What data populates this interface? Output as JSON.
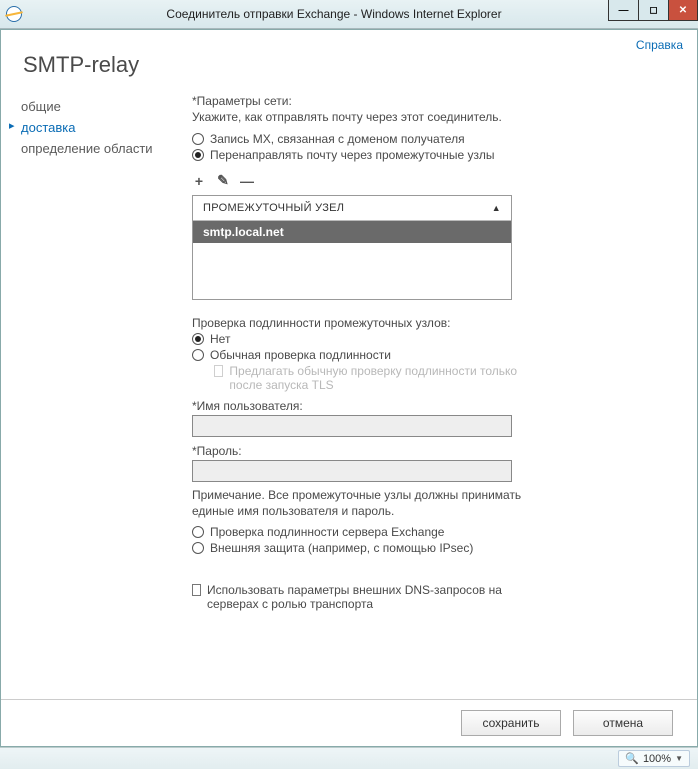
{
  "window": {
    "title": "Соединитель отправки Exchange - Windows Internet Explorer"
  },
  "header": {
    "help": "Справка",
    "page_title": "SMTP-relay"
  },
  "sidebar": {
    "items": [
      {
        "label": "общие",
        "active": false
      },
      {
        "label": "доставка",
        "active": true
      },
      {
        "label": "определение области",
        "active": false
      }
    ]
  },
  "network": {
    "label": "*Параметры сети:",
    "desc": "Укажите, как отправлять почту через этот соединитель.",
    "opt_mx": "Запись MX, связанная с доменом получателя",
    "opt_smarthost": "Перенаправлять почту через промежуточные узлы",
    "selected": "smarthost"
  },
  "smarthost_list": {
    "header": "ПРОМЕЖУТОЧНЫЙ УЗЕЛ",
    "items": [
      "smtp.local.net"
    ]
  },
  "auth": {
    "title": "Проверка подлинности промежуточных узлов:",
    "opt_none": "Нет",
    "opt_basic": "Обычная проверка подлинности",
    "basic_tls": "Предлагать обычную проверку подлинности только после запуска TLS",
    "user_label": "*Имя пользователя:",
    "user_value": "",
    "pass_label": "*Пароль:",
    "pass_value": "",
    "note": "Примечание. Все промежуточные узлы должны принимать единые имя пользователя и пароль.",
    "opt_exchange": "Проверка подлинности сервера Exchange",
    "opt_external": "Внешняя защита (например, с помощью IPsec)",
    "selected": "none"
  },
  "dns": {
    "label": "Использовать параметры внешних DNS-запросов на серверах с ролью транспорта",
    "checked": false
  },
  "footer": {
    "save": "сохранить",
    "cancel": "отмена"
  },
  "status": {
    "zoom": "100%"
  }
}
